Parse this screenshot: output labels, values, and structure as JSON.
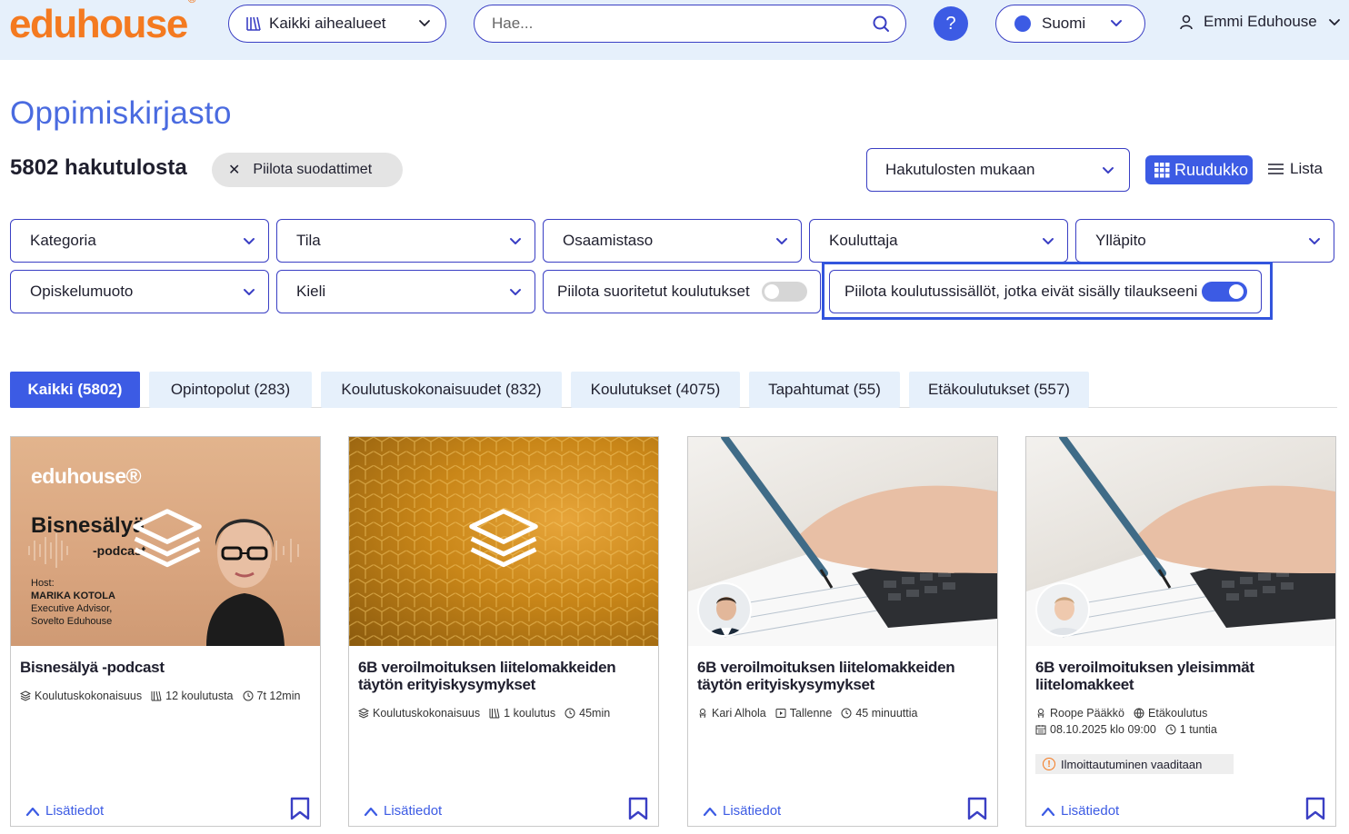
{
  "header": {
    "logo": "eduhouse",
    "logo_mark": "®",
    "topics_label": "Kaikki aihealueet",
    "search_placeholder": "Hae...",
    "help_label": "?",
    "language": "Suomi",
    "user_name": "Emmi Eduhouse"
  },
  "page": {
    "title": "Oppimiskirjasto",
    "results": "5802 hakutulosta",
    "hide_filters": "Piilota suodattimet",
    "sort_label": "Hakutulosten mukaan",
    "view_grid": "Ruudukko",
    "view_list": "Lista"
  },
  "filters": {
    "kategoria": "Kategoria",
    "tila": "Tila",
    "osaamistaso": "Osaamistaso",
    "kouluttaja": "Kouluttaja",
    "yllapito": "Ylläpito",
    "opiskelumuoto": "Opiskelumuoto",
    "kieli": "Kieli",
    "hide_completed": "Piilota suoritetut koulutukset",
    "hide_completed_on": false,
    "hide_not_in_subscription": "Piilota koulutussisällöt, jotka eivät sisälly tilaukseeni",
    "hide_not_in_subscription_on": true
  },
  "tabs": [
    {
      "label": "Kaikki (5802)",
      "active": true
    },
    {
      "label": "Opintopolut (283)",
      "active": false
    },
    {
      "label": "Koulutuskokonaisuudet (832)",
      "active": false
    },
    {
      "label": "Koulutukset (4075)",
      "active": false
    },
    {
      "label": "Tapahtumat (55)",
      "active": false
    },
    {
      "label": "Etäkoulutukset (557)",
      "active": false
    }
  ],
  "cards": [
    {
      "title": "Bisnesälyä -podcast",
      "image_texts": {
        "logo": "eduhouse®",
        "podcast_title": "Bisnesälyä",
        "podcast_sub": "-podcast",
        "host_label": "Host:",
        "host_name": "MARIKA KOTOLA",
        "host_role1": "Executive Advisor,",
        "host_role2": "Sovelto Eduhouse"
      },
      "meta1": "Koulutuskokonaisuus",
      "meta2": "12 koulutusta",
      "meta3": "7t 12min",
      "more": "Lisätiedot"
    },
    {
      "title": "6B veroilmoituksen liitelomakkeiden täytön erityiskysymykset",
      "meta1": "Koulutuskokonaisuus",
      "meta2": "1 koulutus",
      "meta3": "45min",
      "more": "Lisätiedot"
    },
    {
      "title": "6B veroilmoituksen liitelomakkeiden täytön erityiskysymykset",
      "meta1": "Kari Alhola",
      "meta2": "Tallenne",
      "meta3": "45 minuuttia",
      "more": "Lisätiedot"
    },
    {
      "title": "6B veroilmoituksen yleisimmät liitelomakkeet",
      "meta1": "Roope Pääkkö",
      "meta2": "Etäkoulutus",
      "meta3": "08.10.2025 klo 09:00",
      "meta4": "1 tuntia",
      "badge": "Ilmoittautuminen vaaditaan",
      "more": "Lisätiedot"
    }
  ],
  "colors": {
    "brand_orange": "#f47a20",
    "accent_blue": "#3c5be4",
    "header_bg": "#e6f0fb"
  }
}
